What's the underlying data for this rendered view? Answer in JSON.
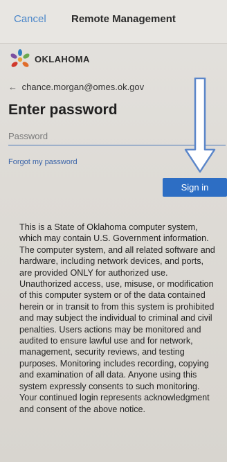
{
  "header": {
    "cancel_label": "Cancel",
    "title": "Remote Management"
  },
  "branding": {
    "logo_text": "OKLAHOMA"
  },
  "account": {
    "email": "chance.morgan@omes.ok.gov"
  },
  "form": {
    "heading": "Enter password",
    "password_placeholder": "Password",
    "password_value": "",
    "forgot_label": "Forgot my password",
    "signin_label": "Sign in"
  },
  "notice": {
    "text": "This is a State of Oklahoma computer system, which may contain U.S. Government information. The computer system, and all related software and hardware, including network devices, and ports, are provided ONLY for authorized use. Unauthorized access, use, misuse, or modification of this computer system or of the data contained herein or in transit to from this system is prohibited and may subject the individual to criminal and civil penalties. Users actions may be monitored and audited to ensure lawful use and for network, management, security reviews, and testing purposes. Monitoring includes recording, copying and examination of all data. Anyone using this system expressly consents to such monitoring. Your continued login represents acknowledgment and consent of the above notice."
  },
  "colors": {
    "accent": "#2d6ec4",
    "link": "#3a64a8",
    "cancel": "#4a86c9",
    "annotation_arrow": "#5b86c9"
  },
  "icons": {
    "back": "back-arrow-icon",
    "logo": "oklahoma-logo",
    "annotation": "down-arrow-annotation"
  }
}
